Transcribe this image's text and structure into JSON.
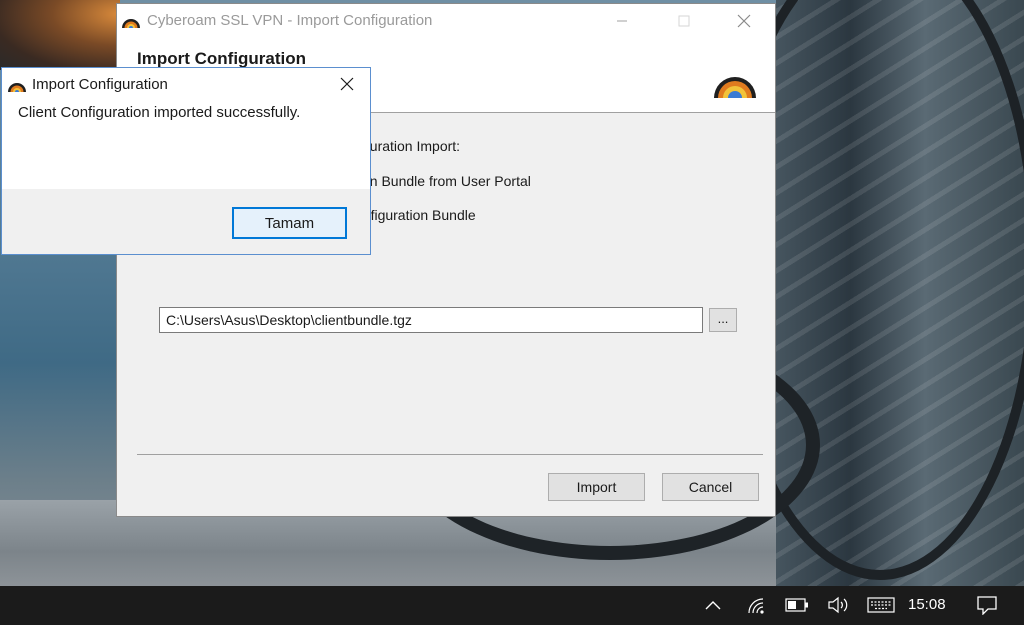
{
  "main_window": {
    "title": "Cyberoam SSL VPN - Import Configuration",
    "header_title": "Import Configuration",
    "content_lines": [
      "figuration Import:",
      "tion Bundle from User Portal",
      "onfiguration Bundle"
    ],
    "file_path": "C:\\Users\\Asus\\Desktop\\clientbundle.tgz",
    "browse_label": "...",
    "import_label": "Import",
    "cancel_label": "Cancel"
  },
  "dialog": {
    "title": "Import Configuration",
    "message": "Client Configuration imported successfully.",
    "ok_label": "Tamam"
  },
  "taskbar": {
    "time": "15:08",
    "tray_icons": [
      "chevron-up-icon",
      "wifi-icon",
      "battery-icon",
      "volume-icon",
      "keyboard-icon",
      "notification-icon"
    ]
  },
  "colors": {
    "accent": "#0078d7",
    "taskbar": "#1b1b1b",
    "window_bg": "#f0f0f0"
  }
}
